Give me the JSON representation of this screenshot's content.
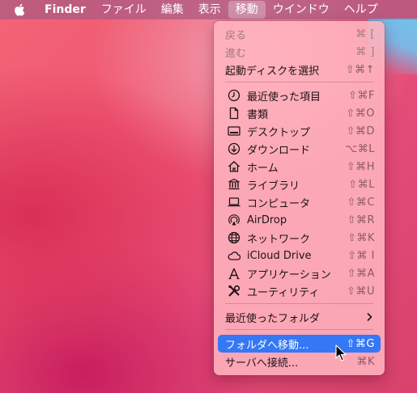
{
  "menubar": {
    "apple_icon": "apple-icon",
    "items": [
      "Finder",
      "ファイル",
      "編集",
      "表示",
      "移動",
      "ウインドウ",
      "ヘルプ"
    ]
  },
  "menu": {
    "back": {
      "label": "戻る",
      "shortcut": "⌘ ["
    },
    "forward": {
      "label": "進む",
      "shortcut": "⌘ ]"
    },
    "startup_disk": {
      "label": "起動ディスクを選択",
      "shortcut": "⇧⌘↑"
    },
    "items": [
      {
        "label": "最近使った項目",
        "shortcut": "⇧⌘F",
        "icon": "clock-icon"
      },
      {
        "label": "書類",
        "shortcut": "⇧⌘O",
        "icon": "document-icon"
      },
      {
        "label": "デスクトップ",
        "shortcut": "⇧⌘D",
        "icon": "desktop-icon"
      },
      {
        "label": "ダウンロード",
        "shortcut": "⌥⌘L",
        "icon": "download-icon"
      },
      {
        "label": "ホーム",
        "shortcut": "⇧⌘H",
        "icon": "home-icon"
      },
      {
        "label": "ライブラリ",
        "shortcut": "⇧⌘L",
        "icon": "library-icon"
      },
      {
        "label": "コンピュータ",
        "shortcut": "⇧⌘C",
        "icon": "computer-icon"
      },
      {
        "label": "AirDrop",
        "shortcut": "⇧⌘R",
        "icon": "airdrop-icon"
      },
      {
        "label": "ネットワーク",
        "shortcut": "⇧⌘K",
        "icon": "network-icon"
      },
      {
        "label": "iCloud Drive",
        "shortcut": "⇧⌘ I",
        "icon": "cloud-icon"
      },
      {
        "label": "アプリケーション",
        "shortcut": "⇧⌘A",
        "icon": "applications-icon"
      },
      {
        "label": "ユーティリティ",
        "shortcut": "⇧⌘U",
        "icon": "utilities-icon"
      }
    ],
    "recent_folders": {
      "label": "最近使ったフォルダ"
    },
    "go_to_folder": {
      "label": "フォルダへ移動...",
      "shortcut": "⇧⌘G"
    },
    "connect_server": {
      "label": "サーバへ接続...",
      "shortcut": "⌘K"
    }
  },
  "colors": {
    "highlight": "#3478f6",
    "menu_bg": "#ffb4be"
  }
}
